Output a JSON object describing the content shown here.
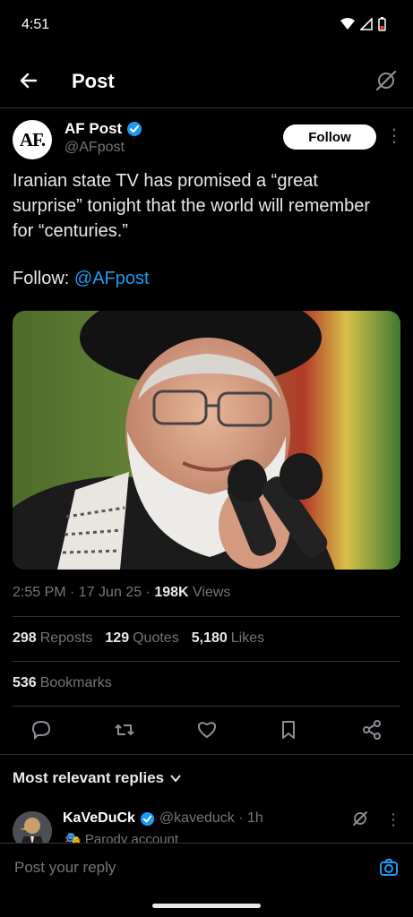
{
  "status_bar": {
    "time": "4:51"
  },
  "header": {
    "title": "Post"
  },
  "post": {
    "avatar_text": "AF.",
    "author_name": "AF Post",
    "handle": "@AFpost",
    "follow_label": "Follow",
    "text": "Iranian state TV has promised a “great surprise” tonight that the world will remember for “centuries.”",
    "follow_prefix": "Follow: ",
    "follow_link": "@AFpost",
    "timestamp": "2:55 PM · 17 Jun 25 · ",
    "views_count": "198K",
    "views_label": " Views",
    "reposts_count": "298",
    "reposts_label": "Reposts",
    "quotes_count": "129",
    "quotes_label": "Quotes",
    "likes_count": "5,180",
    "likes_label": "Likes",
    "bookmarks_count": "536",
    "bookmarks_label": "Bookmarks"
  },
  "replies": {
    "header": "Most relevant replies",
    "items": [
      {
        "name": "KaVeDuCk",
        "handle": "@kaveduck · 1h",
        "badge": "Parody account"
      }
    ]
  },
  "composer": {
    "placeholder": "Post your reply"
  },
  "colors": {
    "accent": "#1d9bf0",
    "background": "#000000",
    "text": "#e7e9ea",
    "muted": "#71767b"
  }
}
